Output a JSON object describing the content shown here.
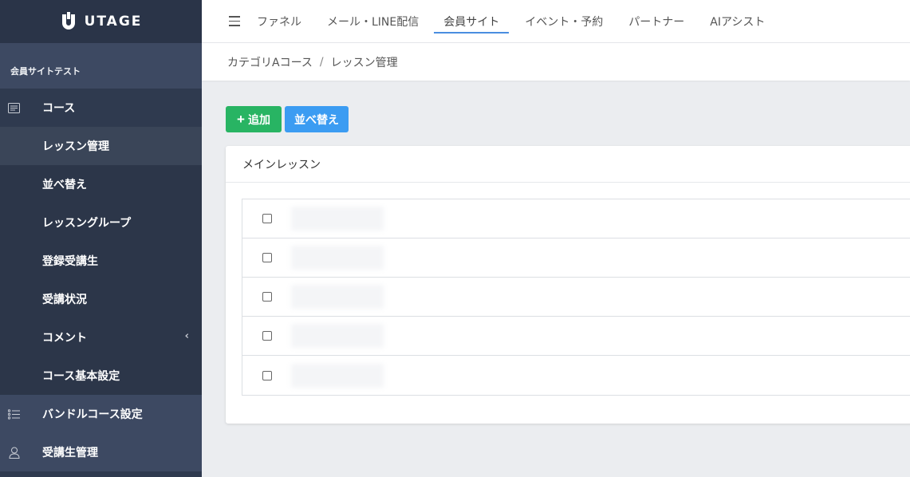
{
  "brand": {
    "name": "UTAGE"
  },
  "sidebar": {
    "site_name": "会員サイトテスト",
    "course_label": "コース",
    "sub_items": [
      {
        "label": "レッスン管理",
        "active": true
      },
      {
        "label": "並べ替え"
      },
      {
        "label": "レッスングループ"
      },
      {
        "label": "登録受講生"
      },
      {
        "label": "受講状況"
      },
      {
        "label": "コメント",
        "has_chevron": true
      },
      {
        "label": "コース基本設定"
      }
    ],
    "bundle_label": "バンドルコース設定",
    "students_label": "受講生管理",
    "chevron": "‹"
  },
  "topnav": {
    "tabs": [
      {
        "label": "ファネル"
      },
      {
        "label": "メール・LINE配信"
      },
      {
        "label": "会員サイト",
        "active": true
      },
      {
        "label": "イベント・予約"
      },
      {
        "label": "パートナー"
      },
      {
        "label": "AIアシスト"
      }
    ],
    "accent_color": "#4a8ee0"
  },
  "breadcrumb": {
    "parent": "カテゴリAコース",
    "separator": "/",
    "current": "レッスン管理"
  },
  "toolbar": {
    "add_plus": "+",
    "add_label": "追加",
    "sort_label": "並べ替え"
  },
  "card": {
    "title": "メインレッスン",
    "lessons": [
      {
        "name": ""
      },
      {
        "name": ""
      },
      {
        "name": ""
      },
      {
        "name": ""
      },
      {
        "name": ""
      }
    ]
  },
  "colors": {
    "sidebar_bg": "#2f3a4f",
    "add_button": "#28b463",
    "sort_button": "#3b9cf2"
  }
}
